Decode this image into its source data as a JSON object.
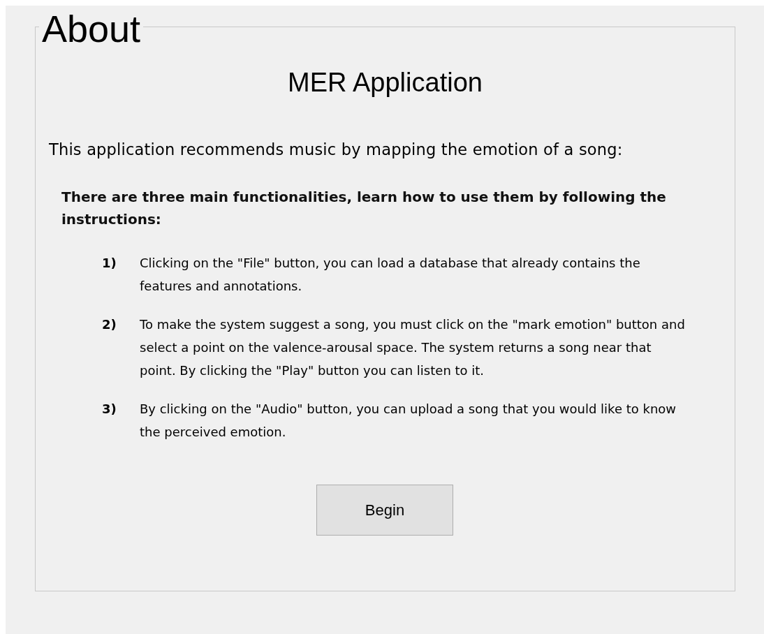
{
  "group": {
    "title": "About"
  },
  "heading": "MER Application",
  "intro": "This application recommends music by mapping the emotion of a song:",
  "subheading": "There are three main functionalities, learn how to use them by following the instructions:",
  "instructions": [
    {
      "number": "1)",
      "text": "Clicking on the \"File\" button, you can load a database that already contains the features and annotations."
    },
    {
      "number": "2)",
      "text": "To make the system suggest a song, you must click on the \"mark emotion\" button and select a point on the valence-arousal space. The system returns a song near that point. By clicking the \"Play\" button you can listen to it."
    },
    {
      "number": "3)",
      "text": "By clicking on the \"Audio\" button, you can upload a song that you would like to know the perceived emotion."
    }
  ],
  "button": "Begin"
}
